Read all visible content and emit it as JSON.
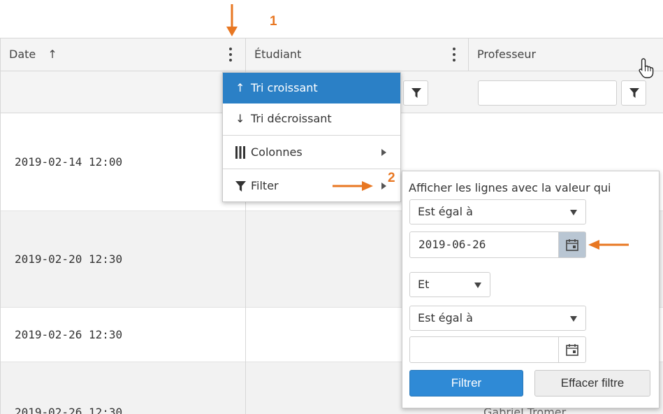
{
  "annotations": {
    "step1": "1",
    "step2": "2"
  },
  "colors": {
    "annotation": "#e87722",
    "accent": "#2b80c6",
    "primary_button": "#2f8ad6"
  },
  "grid": {
    "columns": [
      {
        "label": "Date",
        "sort_icon": "↑",
        "sort_icon_name": "sort-ascending-icon"
      },
      {
        "label": "Étudiant"
      },
      {
        "label": "Professeur"
      }
    ],
    "rows": [
      {
        "date": "2019-02-14 12:00"
      },
      {
        "date": "2019-02-20 12:30"
      },
      {
        "date": "2019-02-26 12:30"
      },
      {
        "date": "2019-02-26 12:30",
        "professeur": "Gabriel Tromer"
      }
    ]
  },
  "column_menu": {
    "items": [
      {
        "icon": "↑",
        "icon_name": "sort-ascending-icon",
        "label": "Tri croissant"
      },
      {
        "icon": "↓",
        "icon_name": "sort-descending-icon",
        "label": "Tri décroissant"
      },
      {
        "icon_name": "columns-icon",
        "label": "Colonnes"
      },
      {
        "icon_name": "filter-icon",
        "label": "Filter"
      }
    ]
  },
  "filter_popup": {
    "title": "Afficher les lignes avec la valeur qui",
    "operator1": "Est égal à",
    "value1": "2019-06-26",
    "logic": "Et",
    "operator2": "Est égal à",
    "value2": "",
    "filter_button": "Filtrer",
    "clear_button": "Effacer filtre"
  },
  "cursor_icon": "hand-pointer-icon"
}
